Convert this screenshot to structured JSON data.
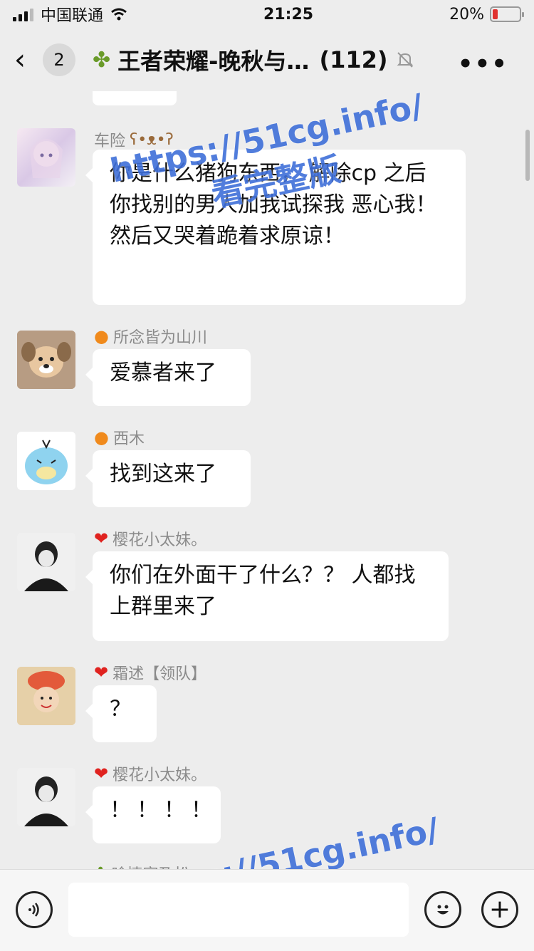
{
  "status_bar": {
    "carrier": "中国联通",
    "time": "21:25",
    "battery": "20%",
    "battery_level": 0.2
  },
  "nav": {
    "back_icon": "chevron-left-icon",
    "unread_count": "2",
    "title": "王者荣耀-晚秋与…",
    "member_count": "(112)",
    "more_icon": "more-dots-icon"
  },
  "messages": [
    {
      "sender": "车险",
      "text": "你是什么猪狗东西， 解除cp 之后 你找别的男人加我试探我 恶心我！然后又哭着跪着求原谅！"
    },
    {
      "sender": "所念皆为山川",
      "text": "爱慕者来了"
    },
    {
      "sender": "西木",
      "text": "找到这来了"
    },
    {
      "sender": "樱花小太妹。",
      "text": "你们在外面干了什么？？ 人都找上群里来了"
    },
    {
      "sender": "霜述【领队】",
      "text": "？"
    },
    {
      "sender": "樱花小太妹。",
      "text": "！！！！"
    },
    {
      "sender": "晗情家及松"
    }
  ],
  "watermark": {
    "url": "https://51cg.info/",
    "caption": "看完整版"
  },
  "input_bar": {
    "voice_icon": "voice-icon",
    "emoji_icon": "emoji-icon",
    "plus_icon": "plus-icon",
    "plus_glyph": "+"
  }
}
